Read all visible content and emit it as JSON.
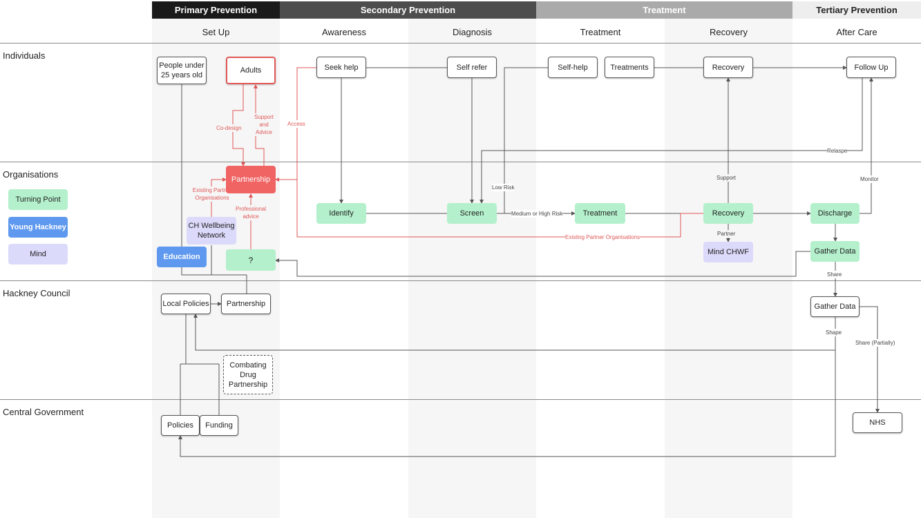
{
  "phases": {
    "primary": "Primary Prevention",
    "secondary": "Secondary Prevention",
    "treatment": "Treatment",
    "tertiary": "Tertiary Prevention"
  },
  "stages": [
    "Set Up",
    "Awareness",
    "Diagnosis",
    "Treatment",
    "Recovery",
    "After Care"
  ],
  "lanes": [
    "Individuals",
    "Organisations",
    "Hackney Council",
    "Central Government"
  ],
  "legend": {
    "turning_point": "Turning Point",
    "young_hackney": "Young Hackney",
    "mind": "Mind"
  },
  "nodes": {
    "people_under_25": "People under 25 years old",
    "adults": "Adults",
    "seek_help": "Seek help",
    "self_refer": "Self refer",
    "self_help": "Self-help",
    "treatments": "Treatments",
    "recovery_individual": "Recovery",
    "follow_up": "Follow Up",
    "partnership_org": "Partnership",
    "ch_wellbeing": "CH Wellbeing Network",
    "education": "Education",
    "question": "?",
    "identify": "Identify",
    "screen": "Screen",
    "treatment_org": "Treatment",
    "recovery_org": "Recovery",
    "mind_chwf": "Mind CHWF",
    "discharge": "Discharge",
    "gather_data_org": "Gather Data",
    "local_policies": "Local Policies",
    "partnership_council": "Partnership",
    "combating_drug": "Combating Drug Partnership",
    "gather_data_council": "Gather Data",
    "policies": "Policies",
    "funding": "Funding",
    "nhs": "NHS"
  },
  "edge_labels": {
    "co_design": "Co-design",
    "support_and_advice": "Support and Advice",
    "access": "Access",
    "existing_partner_orgs": "Existing Partner Organisations",
    "professional_advice": "Professional advice",
    "low_risk": "Low Risk",
    "medium_high_risk": "Medium or High Risk",
    "relapse": "Relaspe",
    "support": "Support",
    "monitor": "Monitor",
    "partner": "Partner",
    "existing_partner_orgs_long": "Existing Partner Organisations",
    "share": "Share",
    "shape": "Shape",
    "share_partially": "Share (Partially)"
  },
  "colors": {
    "primary_phase": "#1a1a1a",
    "secondary_phase": "#4d4d4d",
    "treatment_phase": "#aaaaaa",
    "tertiary_phase": "#eeeeee",
    "turning_point": "#b4f0cc",
    "young_hackney": "#5f99ef",
    "mind": "#dcdafa",
    "red_accent": "#f06464"
  }
}
